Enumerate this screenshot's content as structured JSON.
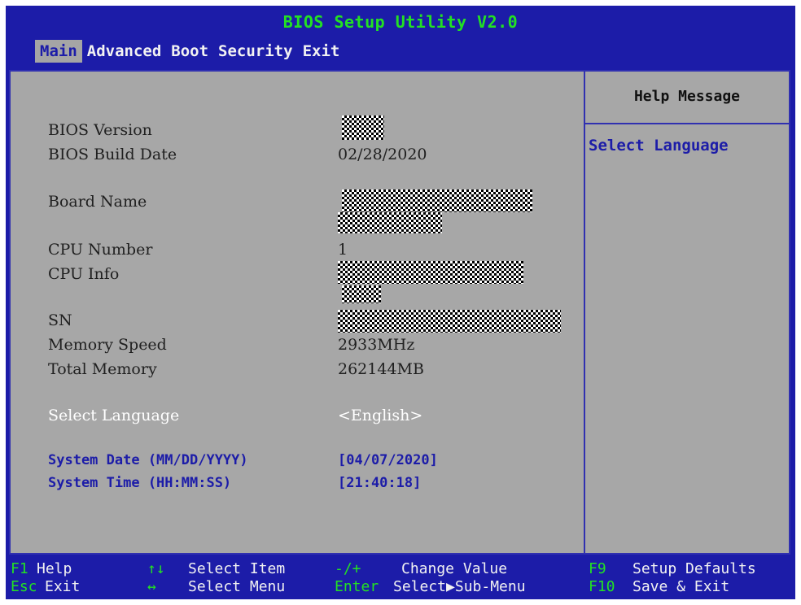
{
  "title": "BIOS Setup Utility V2.0",
  "menu": [
    "Main",
    "Advanced",
    "Boot",
    "Security",
    "Exit"
  ],
  "fields": {
    "bios_version_label": "BIOS Version",
    "bios_build_date_label": "BIOS Build Date",
    "bios_build_date_value": "02/28/2020",
    "board_name_label": "Board Name",
    "cpu_number_label": "CPU Number",
    "cpu_number_value": "1",
    "cpu_info_label": "CPU Info",
    "sn_label": "SN",
    "memory_speed_label": "Memory Speed",
    "memory_speed_value": "2933MHz",
    "total_memory_label": "Total Memory",
    "total_memory_value": "262144MB"
  },
  "settings": {
    "language_label": "Select Language",
    "language_value": "<English>",
    "date_label": "System Date (MM/DD/YYYY)",
    "date_value": "[04/07/2020]",
    "time_label": "System Time (HH:MM:SS)",
    "time_value": "[21:40:18]"
  },
  "help": {
    "title": "Help Message",
    "text": "Select Language"
  },
  "footer": {
    "f1_key": "F1",
    "f1_desc": "Help",
    "arrows_ud_key": "↑↓",
    "arrows_ud_desc": "Select Item",
    "pm_key": "-/+",
    "pm_desc": "Change Value",
    "f9_key": "F9",
    "f9_desc": "Setup Defaults",
    "esc_key": "Esc",
    "esc_desc": "Exit",
    "arrows_lr_key": "↔",
    "arrows_lr_desc": "Select Menu",
    "enter_key": "Enter",
    "enter_desc": "Select▶Sub-Menu",
    "f10_key": "F10",
    "f10_desc": "Save & Exit"
  }
}
